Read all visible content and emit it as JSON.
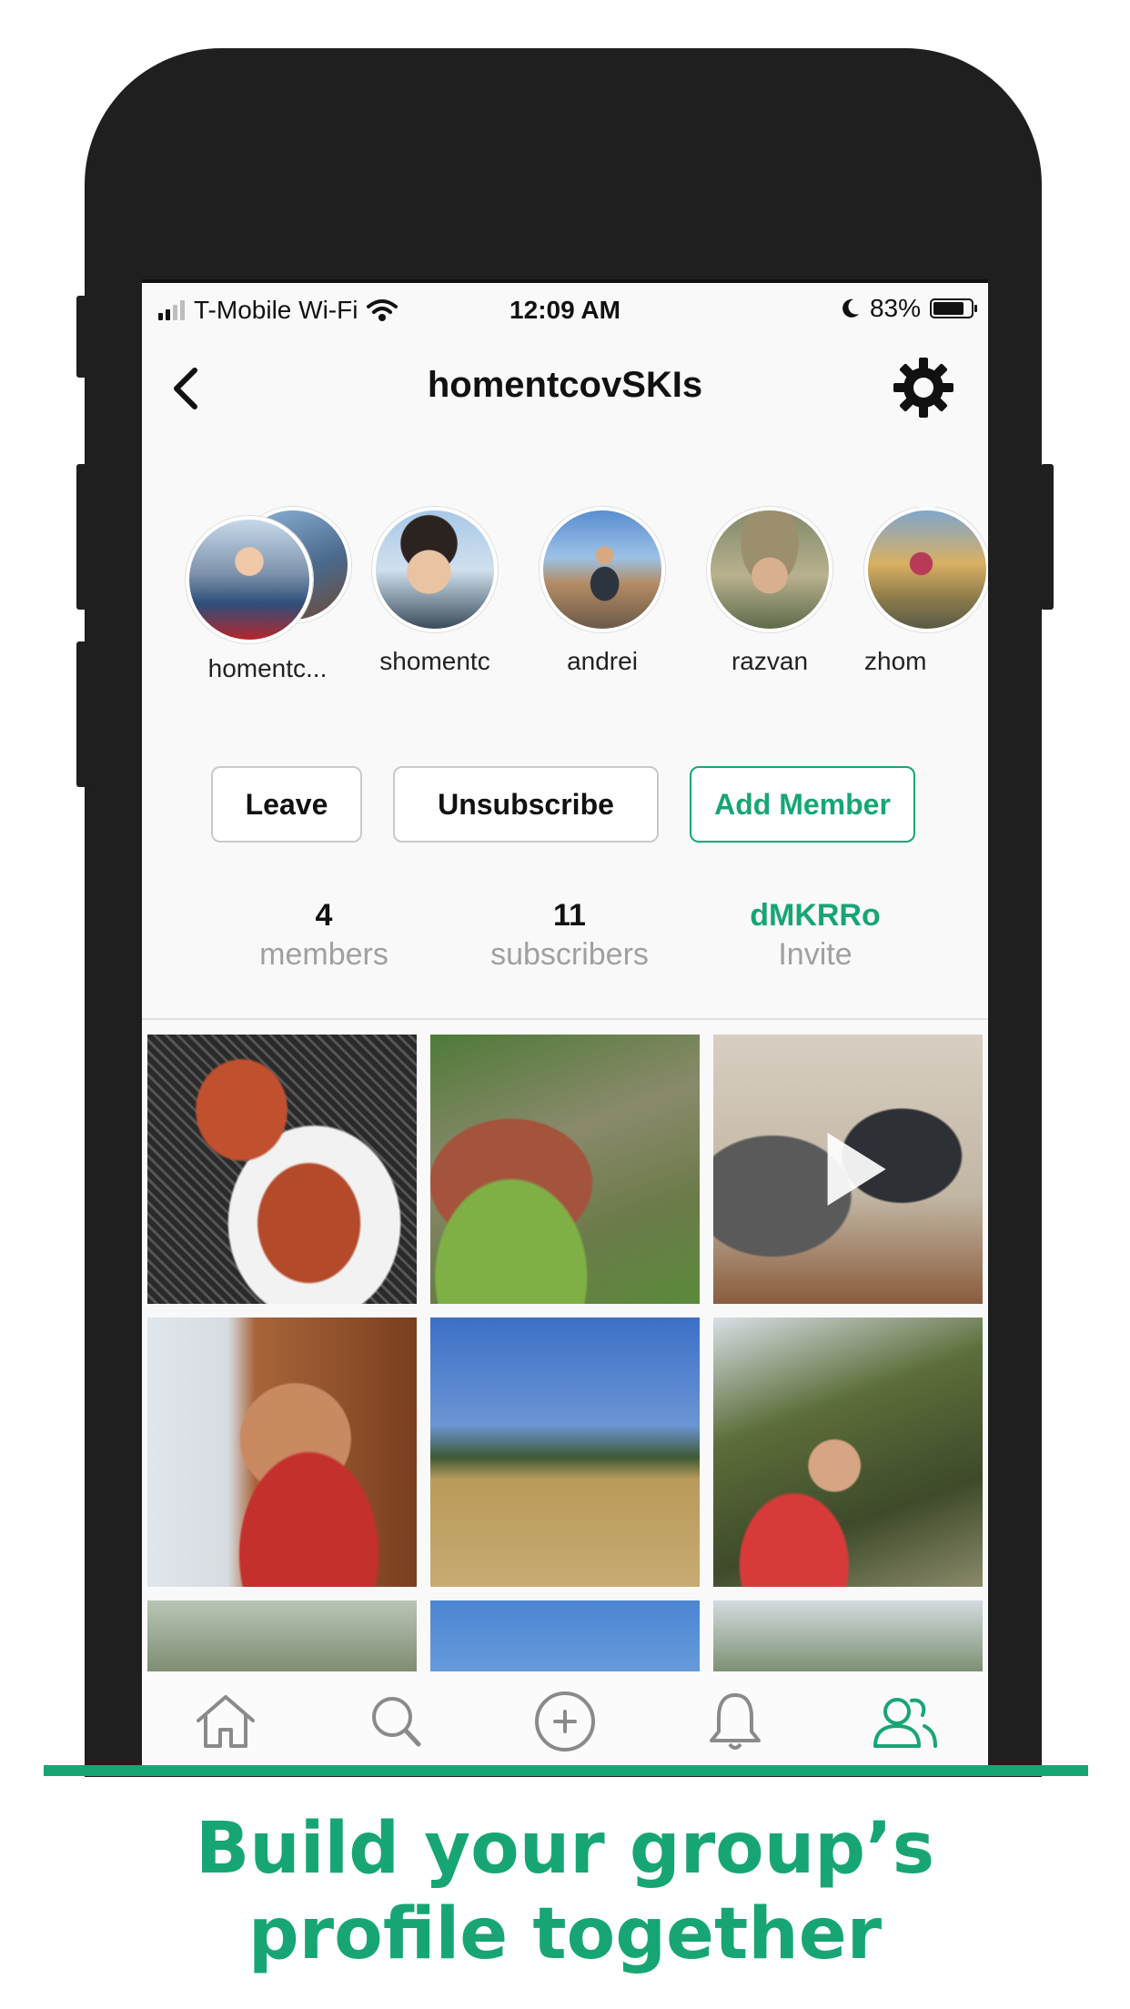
{
  "status_bar": {
    "carrier": "T-Mobile Wi-Fi",
    "time": "12:09 AM",
    "battery": "83%",
    "battery_level": 0.83
  },
  "nav": {
    "title": "homentcovSKIs"
  },
  "members": [
    {
      "name": "homentc..."
    },
    {
      "name": "shomentc"
    },
    {
      "name": "andrei"
    },
    {
      "name": "razvan"
    },
    {
      "name": "zhom"
    }
  ],
  "actions": {
    "leave": "Leave",
    "unsubscribe": "Unsubscribe",
    "add_member": "Add Member"
  },
  "stats": {
    "members_count": "4",
    "members_label": "members",
    "subscribers_count": "11",
    "subscribers_label": "subscribers",
    "invite_code": "dMKRRo",
    "invite_label": "Invite"
  },
  "icons": {
    "back": "chevron-left-icon",
    "settings": "gear-icon",
    "tabs": [
      "home-icon",
      "search-icon",
      "add-circle-icon",
      "bell-icon",
      "group-icon"
    ]
  },
  "colors": {
    "accent": "#17a673",
    "frame": "#1f1f1f"
  },
  "caption": {
    "line1": "Build your group’s",
    "line2": "profile together"
  }
}
